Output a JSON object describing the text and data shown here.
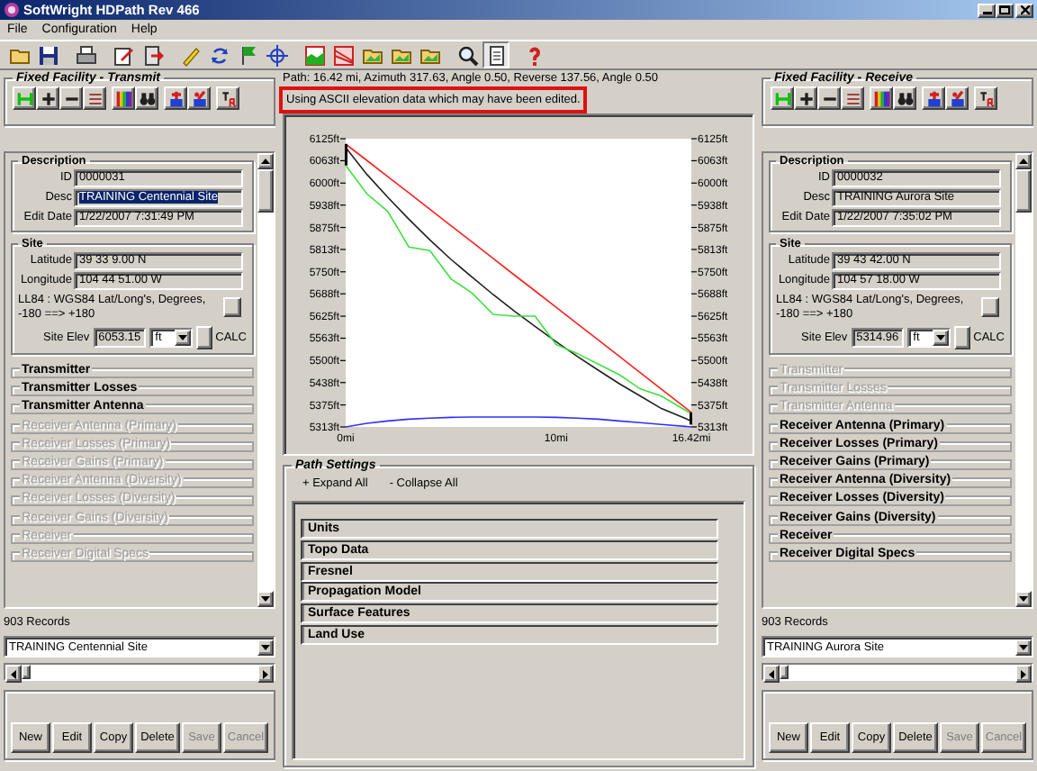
{
  "window": {
    "title": "SoftWright HDPath Rev 466"
  },
  "menu": [
    "File",
    "Configuration",
    "Help"
  ],
  "facilities": [
    {
      "title": "Fixed Facility - Transmit",
      "description": {
        "heading": "Description",
        "id_label": "ID",
        "id": "0000031",
        "desc_label": "Desc",
        "desc": "TRAINING Centennial Site",
        "desc_selected": true,
        "date_label": "Edit Date",
        "date": "1/22/2007 7:31:49 PM"
      },
      "site": {
        "heading": "Site",
        "latitude_label": "Latitude",
        "latitude": "39 33 9.00 N",
        "longitude_label": "Longitude",
        "longitude": "104 44 51.00 W",
        "datum": "LL84 : WGS84 Lat/Long's, Degrees, -180 ==> +180",
        "elev_label": "Site Elev",
        "elev": "6053.15",
        "unit": "ft",
        "calc": "CALC"
      },
      "sections": [
        {
          "label": "Transmitter",
          "enabled": true
        },
        {
          "label": "Transmitter Losses",
          "enabled": true
        },
        {
          "label": "Transmitter Antenna",
          "enabled": true
        },
        {
          "label": "Receiver Antenna (Primary)",
          "enabled": false
        },
        {
          "label": "Receiver Losses (Primary)",
          "enabled": false
        },
        {
          "label": "Receiver Gains (Primary)",
          "enabled": false
        },
        {
          "label": "Receiver Antenna (Diversity)",
          "enabled": false
        },
        {
          "label": "Receiver Losses (Diversity)",
          "enabled": false
        },
        {
          "label": "Receiver Gains (Diversity)",
          "enabled": false
        },
        {
          "label": "Receiver",
          "enabled": false
        },
        {
          "label": "Receiver Digital Specs",
          "enabled": false
        }
      ],
      "records": "903 Records",
      "site_select": "TRAINING Centennial Site",
      "buttons": [
        {
          "label": "New",
          "disabled": false
        },
        {
          "label": "Edit",
          "disabled": false
        },
        {
          "label": "Copy",
          "disabled": false
        },
        {
          "label": "Delete",
          "disabled": false
        },
        {
          "label": "Save",
          "disabled": true
        },
        {
          "label": "Cancel",
          "disabled": true
        }
      ]
    },
    {
      "title": "Fixed Facility - Receive",
      "description": {
        "heading": "Description",
        "id_label": "ID",
        "id": "0000032",
        "desc_label": "Desc",
        "desc": "TRAINING Aurora Site",
        "desc_selected": false,
        "date_label": "Edit Date",
        "date": "1/22/2007 7:35:02 PM"
      },
      "site": {
        "heading": "Site",
        "latitude_label": "Latitude",
        "latitude": "39 43 42.00 N",
        "longitude_label": "Longitude",
        "longitude": "104 57 18.00 W",
        "datum": "LL84 : WGS84 Lat/Long's, Degrees, -180 ==> +180",
        "elev_label": "Site Elev",
        "elev": "5314.96",
        "unit": "ft",
        "calc": "CALC"
      },
      "sections": [
        {
          "label": "Transmitter",
          "enabled": false
        },
        {
          "label": "Transmitter Losses",
          "enabled": false
        },
        {
          "label": "Transmitter Antenna",
          "enabled": false
        },
        {
          "label": "Receiver Antenna (Primary)",
          "enabled": true
        },
        {
          "label": "Receiver Losses (Primary)",
          "enabled": true
        },
        {
          "label": "Receiver Gains (Primary)",
          "enabled": true
        },
        {
          "label": "Receiver Antenna (Diversity)",
          "enabled": true
        },
        {
          "label": "Receiver Losses (Diversity)",
          "enabled": true
        },
        {
          "label": "Receiver Gains (Diversity)",
          "enabled": true
        },
        {
          "label": "Receiver",
          "enabled": true
        },
        {
          "label": "Receiver Digital Specs",
          "enabled": true
        }
      ],
      "records": "903 Records",
      "site_select": "TRAINING Aurora Site",
      "buttons": [
        {
          "label": "New",
          "disabled": false
        },
        {
          "label": "Edit",
          "disabled": false
        },
        {
          "label": "Copy",
          "disabled": false
        },
        {
          "label": "Delete",
          "disabled": false
        },
        {
          "label": "Save",
          "disabled": true
        },
        {
          "label": "Cancel",
          "disabled": true
        }
      ]
    }
  ],
  "path": {
    "summary": "Path: 16.42 mi, Azimuth 317.63, Angle 0.50, Reverse 137.56, Angle 0.50",
    "message": "Using ASCII elevation data which may have been edited.",
    "message_highlighted": true,
    "chart_data": {
      "type": "line",
      "x": [
        0,
        1,
        2,
        3,
        4,
        5,
        6,
        7,
        8,
        9,
        10,
        11,
        12,
        13,
        14,
        15,
        16.42
      ],
      "series": [
        {
          "color": "#ff2020",
          "values": [
            6110,
            6064,
            6018,
            5972,
            5926,
            5880,
            5834,
            5788,
            5742,
            5696,
            5650,
            5604,
            5558,
            5512,
            5466,
            5419,
            5354
          ]
        },
        {
          "color": "#202020",
          "values": [
            6100,
            6025,
            5960,
            5898,
            5840,
            5785,
            5735,
            5686,
            5640,
            5596,
            5553,
            5512,
            5473,
            5435,
            5400,
            5365,
            5330
          ]
        },
        {
          "color": "#40e040",
          "values": [
            6050,
            5970,
            5920,
            5820,
            5810,
            5730,
            5690,
            5630,
            5625,
            5625,
            5545,
            5520,
            5490,
            5460,
            5420,
            5400,
            5350
          ]
        },
        {
          "color": "#3030ff",
          "values": [
            5313,
            5323,
            5330,
            5335,
            5338,
            5340,
            5341,
            5341,
            5341,
            5341,
            5340,
            5338,
            5335,
            5330,
            5325,
            5320,
            5313
          ]
        }
      ],
      "xlim": [
        0,
        16.42
      ],
      "ylim": [
        5313,
        6125
      ],
      "xticks": [
        {
          "value": 0,
          "label": "0mi"
        },
        {
          "value": 10,
          "label": "10mi"
        },
        {
          "value": 16.42,
          "label": "16.42mi"
        }
      ],
      "yticks": [
        {
          "value": 5313,
          "label": "5313ft"
        },
        {
          "value": 5375,
          "label": "5375ft"
        },
        {
          "value": 5438,
          "label": "5438ft"
        },
        {
          "value": 5500,
          "label": "5500ft"
        },
        {
          "value": 5563,
          "label": "5563ft"
        },
        {
          "value": 5625,
          "label": "5625ft"
        },
        {
          "value": 5688,
          "label": "5688ft"
        },
        {
          "value": 5750,
          "label": "5750ft"
        },
        {
          "value": 5813,
          "label": "5813ft"
        },
        {
          "value": 5875,
          "label": "5875ft"
        },
        {
          "value": 5938,
          "label": "5938ft"
        },
        {
          "value": 6000,
          "label": "6000ft"
        },
        {
          "value": 6063,
          "label": "6063ft"
        },
        {
          "value": 6125,
          "label": "6125ft"
        }
      ]
    }
  },
  "path_settings": {
    "title": "Path Settings",
    "expand": "+ Expand All",
    "collapse": "- Collapse All",
    "items": [
      "Units",
      "Topo Data",
      "Fresnel",
      "Propagation Model",
      "Surface Features",
      "Land Use"
    ]
  }
}
